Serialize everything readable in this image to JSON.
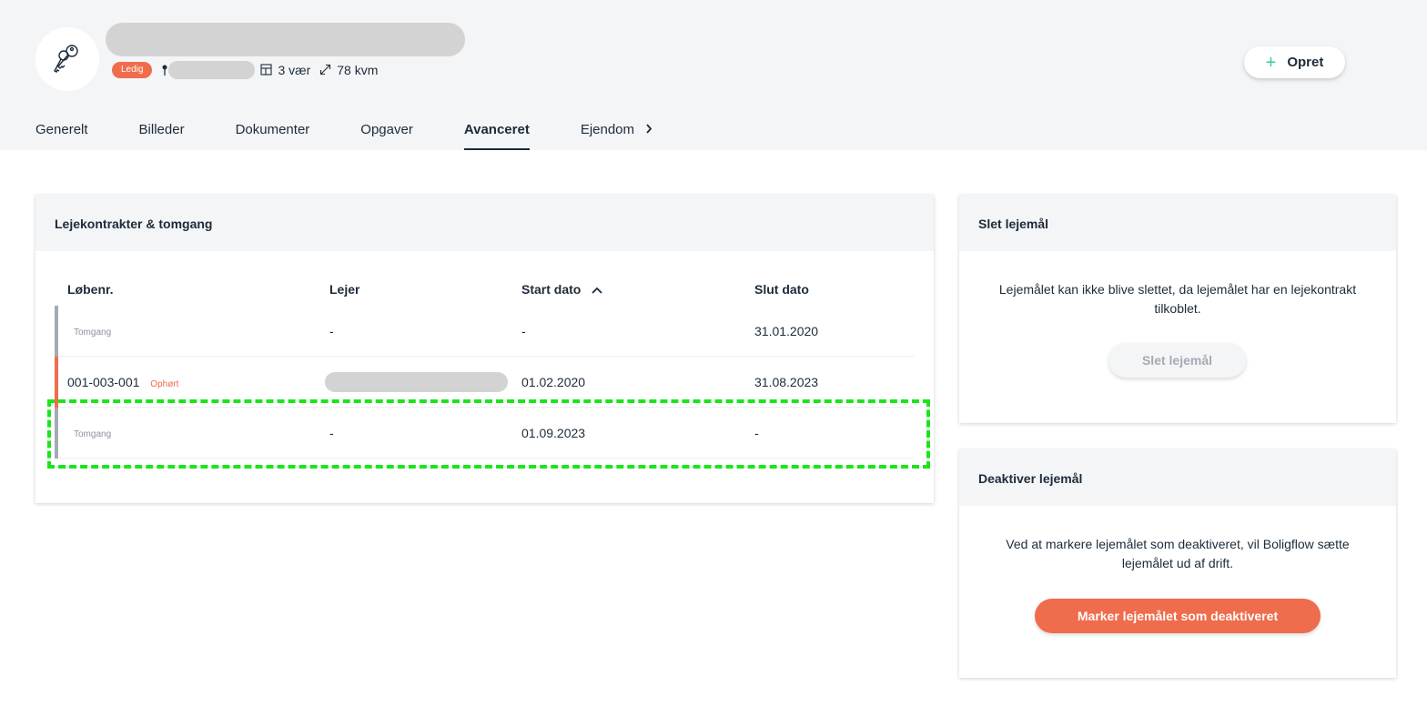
{
  "unit": {
    "status_badge": "Ledig",
    "rooms": "3 vær",
    "area": "78 kvm"
  },
  "header": {
    "create_label": "Opret",
    "create_icon": "plus-icon"
  },
  "tabs": [
    {
      "label": "Generelt",
      "active": false
    },
    {
      "label": "Billeder",
      "active": false
    },
    {
      "label": "Dokumenter",
      "active": false
    },
    {
      "label": "Opgaver",
      "active": false
    },
    {
      "label": "Avanceret",
      "active": true
    },
    {
      "label": "Ejendom",
      "active": false
    }
  ],
  "contracts": {
    "title": "Lejekontrakter & tomgang",
    "columns": {
      "number": "Løbenr.",
      "tenant": "Lejer",
      "start": "Start dato",
      "end": "Slut dato"
    },
    "sort_icon": "chevron-up-icon",
    "rows": [
      {
        "number": "Tomgang",
        "status": "",
        "tenant": "-",
        "start": "-",
        "end": "31.01.2020"
      },
      {
        "number": "001-003-001",
        "status": "Ophørt",
        "tenant": "",
        "start": "01.02.2020",
        "end": "31.08.2023"
      },
      {
        "number": "Tomgang",
        "status": "",
        "tenant": "-",
        "start": "01.09.2023",
        "end": "-"
      }
    ]
  },
  "delete_card": {
    "title": "Slet lejemål",
    "text": "Lejemålet kan ikke blive slettet, da lejemålet har en lejekontrakt tilkoblet.",
    "button": "Slet lejemål"
  },
  "deactivate_card": {
    "title": "Deaktiver lejemål",
    "text": "Ved at markere lejemålet som deaktiveret, vil Boligflow sætte lejemålet ud af drift.",
    "button": "Marker lejemålet som deaktiveret"
  },
  "colors": {
    "accent": "#ef6c4c",
    "text": "#1c2b3a",
    "plus": "#3cc7a8",
    "highlight": "#19e619"
  }
}
